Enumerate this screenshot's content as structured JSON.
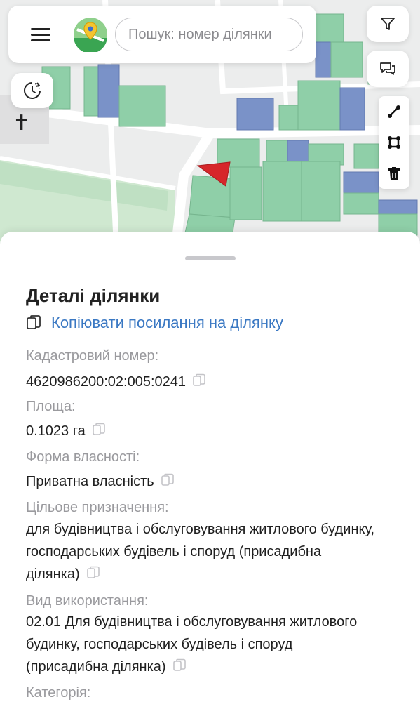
{
  "topbar": {
    "search_placeholder": "Пошук: номер ділянки"
  },
  "icons": {
    "menu": "hamburger-icon",
    "logo": "map-pin-logo",
    "history": "history-clock-icon",
    "filter": "filter-funnel-icon",
    "feedback": "chat-bubbles-icon",
    "measure_line": "measure-line-icon",
    "measure_area": "measure-area-icon",
    "delete": "trash-icon",
    "copy": "copy-icon"
  },
  "colors": {
    "selected_parcel": "#d6262a",
    "link": "#3a78c3",
    "parcel_green": "#8fcfa8",
    "parcel_blue": "#7a92c8"
  },
  "sheet": {
    "title": "Деталі ділянки",
    "copy_link_label": "Копіювати посилання на ділянку",
    "fields": [
      {
        "label": "Кадастровий номер:",
        "value": "4620986200:02:005:0241"
      },
      {
        "label": "Площа:",
        "value": "0.1023 га"
      },
      {
        "label": "Форма власності:",
        "value": "Приватна власність"
      },
      {
        "label": "Цільове призначення:",
        "value": "для будівництва і обслуговування житлового будинку, господарських будівель і споруд (присадибна ділянка)"
      },
      {
        "label": "Вид використання:",
        "value": "02.01 Для будівництва і обслуговування житлового будинку, господарських будівель і споруд (присадибна ділянка)"
      },
      {
        "label": "Категорія:"
      }
    ]
  }
}
